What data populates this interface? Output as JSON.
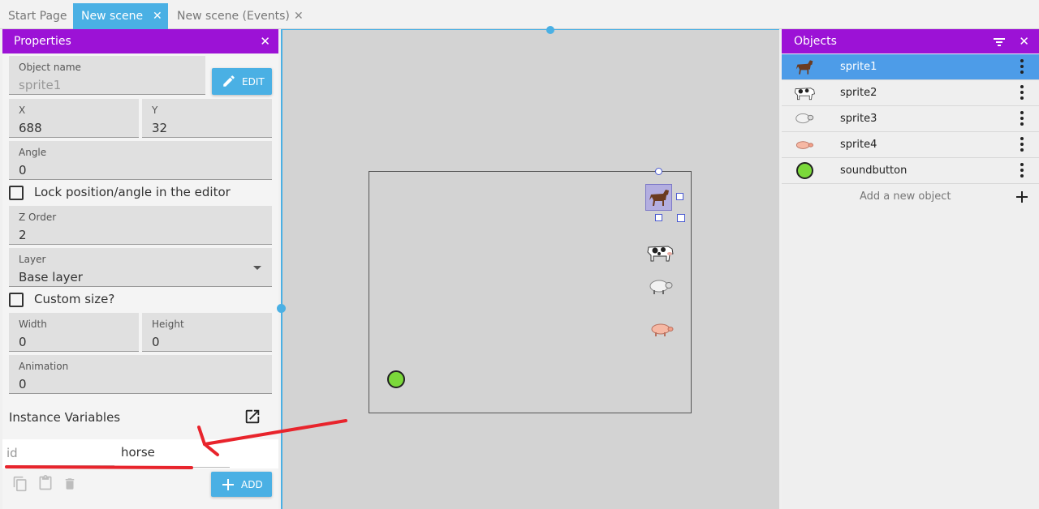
{
  "tabs": [
    {
      "label": "Start Page",
      "closable": false
    },
    {
      "label": "New scene",
      "closable": true,
      "active": true
    },
    {
      "label": "New scene (Events)",
      "closable": true
    }
  ],
  "properties": {
    "title": "Properties",
    "object_name_label": "Object name",
    "object_name_value": "sprite1",
    "edit_label": "EDIT",
    "x_label": "X",
    "x_value": "688",
    "y_label": "Y",
    "y_value": "32",
    "angle_label": "Angle",
    "angle_value": "0",
    "lock_label": "Lock position/angle in the editor",
    "zorder_label": "Z Order",
    "zorder_value": "2",
    "layer_label": "Layer",
    "layer_value": "Base layer",
    "custom_size_label": "Custom size?",
    "width_label": "Width",
    "width_value": "0",
    "height_label": "Height",
    "height_value": "0",
    "animation_label": "Animation",
    "animation_value": "0",
    "instance_vars_label": "Instance Variables",
    "var_name_placeholder": "id",
    "var_value": "horse",
    "add_label": "ADD"
  },
  "objects": {
    "title": "Objects",
    "items": [
      {
        "name": "sprite1",
        "icon": "horse-icon",
        "selected": true
      },
      {
        "name": "sprite2",
        "icon": "cow-icon"
      },
      {
        "name": "sprite3",
        "icon": "sheep-icon"
      },
      {
        "name": "sprite4",
        "icon": "pig-icon"
      },
      {
        "name": "soundbutton",
        "icon": "green-circle-icon"
      }
    ],
    "add_label": "Add a new object"
  },
  "colors": {
    "accent": "#9c12d6",
    "primary": "#4ab0e4",
    "selection": "#4d9ce8",
    "annotation": "#e8242c",
    "sound_button": "#7bd93a"
  }
}
